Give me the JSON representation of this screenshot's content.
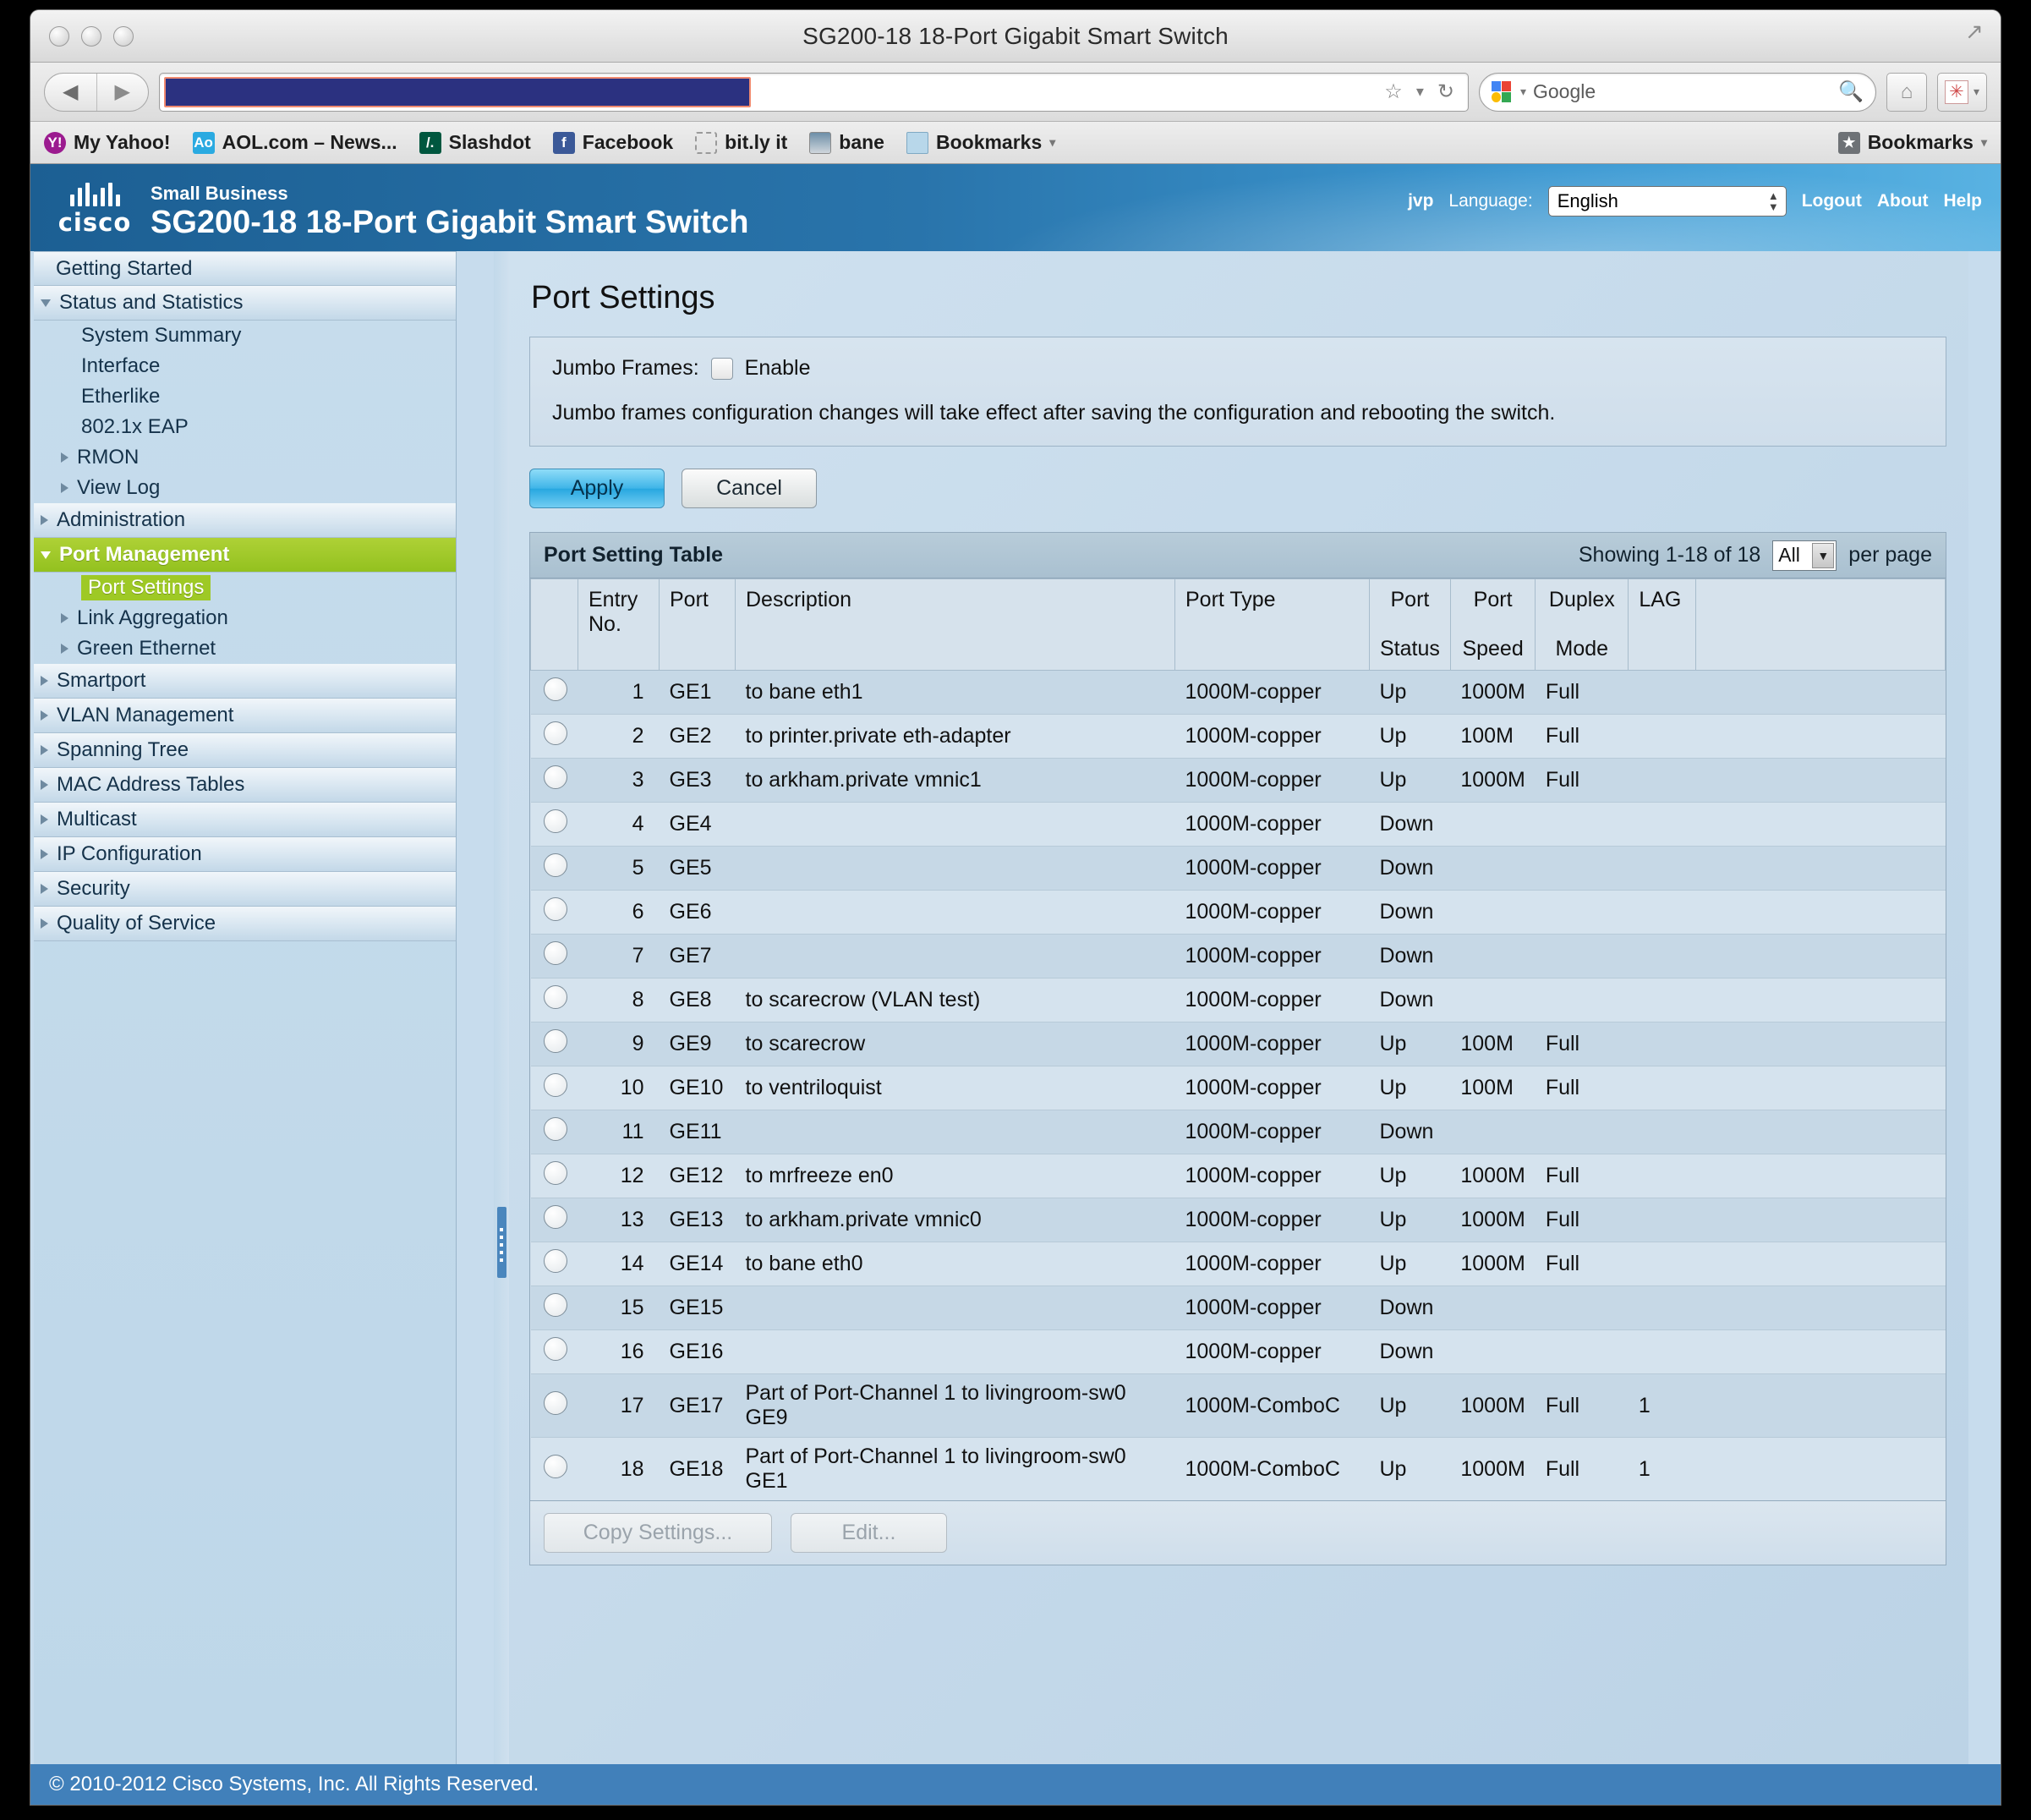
{
  "browser": {
    "window_title": "SG200-18 18-Port Gigabit Smart Switch",
    "url_value": "",
    "search_engine": "Google",
    "bookmarks": [
      {
        "label": "My Yahoo!",
        "icon": "yahoo-icon"
      },
      {
        "label": "AOL.com – News...",
        "icon": "aol-icon"
      },
      {
        "label": "Slashdot",
        "icon": "slashdot-icon"
      },
      {
        "label": "Facebook",
        "icon": "facebook-icon"
      },
      {
        "label": "bit.ly it",
        "icon": "bitly-icon"
      },
      {
        "label": "bane",
        "icon": "computer-icon"
      },
      {
        "label": "Bookmarks",
        "icon": "folder-icon"
      }
    ],
    "bookmarks_right_label": "Bookmarks"
  },
  "header": {
    "logo_word": "cisco",
    "brand_small": "Small Business",
    "brand_title": "SG200-18 18-Port Gigabit Smart Switch",
    "user": "jvp",
    "language_label": "Language:",
    "language_value": "English",
    "links": [
      "Logout",
      "About",
      "Help"
    ]
  },
  "sidebar": {
    "items": [
      {
        "label": "Getting Started",
        "level": "top",
        "arrow": "none",
        "state": "normal"
      },
      {
        "label": "Status and Statistics",
        "level": "top",
        "arrow": "down",
        "state": "normal"
      },
      {
        "label": "System Summary",
        "level": "sub",
        "arrow": "none",
        "state": "normal"
      },
      {
        "label": "Interface",
        "level": "sub",
        "arrow": "none",
        "state": "normal"
      },
      {
        "label": "Etherlike",
        "level": "sub",
        "arrow": "none",
        "state": "normal"
      },
      {
        "label": "802.1x EAP",
        "level": "sub",
        "arrow": "none",
        "state": "normal"
      },
      {
        "label": "RMON",
        "level": "sub",
        "arrow": "right",
        "state": "normal"
      },
      {
        "label": "View Log",
        "level": "sub",
        "arrow": "right",
        "state": "normal"
      },
      {
        "label": "Administration",
        "level": "top",
        "arrow": "right",
        "state": "normal"
      },
      {
        "label": "Port Management",
        "level": "top",
        "arrow": "down",
        "state": "selected"
      },
      {
        "label": "Port Settings",
        "level": "sub",
        "arrow": "none",
        "state": "highlighted"
      },
      {
        "label": "Link Aggregation",
        "level": "sub",
        "arrow": "right",
        "state": "normal"
      },
      {
        "label": "Green Ethernet",
        "level": "sub",
        "arrow": "right",
        "state": "normal"
      },
      {
        "label": "Smartport",
        "level": "top",
        "arrow": "right",
        "state": "normal"
      },
      {
        "label": "VLAN Management",
        "level": "top",
        "arrow": "right",
        "state": "normal"
      },
      {
        "label": "Spanning Tree",
        "level": "top",
        "arrow": "right",
        "state": "normal"
      },
      {
        "label": "MAC Address Tables",
        "level": "top",
        "arrow": "right",
        "state": "normal"
      },
      {
        "label": "Multicast",
        "level": "top",
        "arrow": "right",
        "state": "normal"
      },
      {
        "label": "IP Configuration",
        "level": "top",
        "arrow": "right",
        "state": "normal"
      },
      {
        "label": "Security",
        "level": "top",
        "arrow": "right",
        "state": "normal"
      },
      {
        "label": "Quality of Service",
        "level": "top",
        "arrow": "right",
        "state": "normal"
      }
    ]
  },
  "main": {
    "page_title": "Port Settings",
    "jumbo_label": "Jumbo Frames:",
    "jumbo_enable_label": "Enable",
    "jumbo_checked": false,
    "jumbo_note": "Jumbo frames configuration changes will take effect after saving the configuration and rebooting the switch.",
    "apply_label": "Apply",
    "cancel_label": "Cancel",
    "table": {
      "caption": "Port Setting Table",
      "showing": "Showing 1-18 of 18",
      "per_page_value": "All",
      "per_page_label": "per page",
      "columns": [
        "Entry No.",
        "Port",
        "Description",
        "Port Type",
        "Port Status",
        "Port Speed",
        "Duplex Mode",
        "LAG"
      ],
      "columns_line1": [
        "Entry No.",
        "Port",
        "Description",
        "Port Type",
        "Port",
        "Port",
        "Duplex",
        "LAG"
      ],
      "columns_line2": [
        "",
        "",
        "",
        "",
        "Status",
        "Speed",
        "Mode",
        ""
      ],
      "rows": [
        {
          "entry": "1",
          "port": "GE1",
          "description": "to bane eth1",
          "port_type": "1000M-copper",
          "status": "Up",
          "speed": "1000M",
          "duplex": "Full",
          "lag": ""
        },
        {
          "entry": "2",
          "port": "GE2",
          "description": "to printer.private eth-adapter",
          "port_type": "1000M-copper",
          "status": "Up",
          "speed": "100M",
          "duplex": "Full",
          "lag": ""
        },
        {
          "entry": "3",
          "port": "GE3",
          "description": "to arkham.private vmnic1",
          "port_type": "1000M-copper",
          "status": "Up",
          "speed": "1000M",
          "duplex": "Full",
          "lag": ""
        },
        {
          "entry": "4",
          "port": "GE4",
          "description": "",
          "port_type": "1000M-copper",
          "status": "Down",
          "speed": "",
          "duplex": "",
          "lag": ""
        },
        {
          "entry": "5",
          "port": "GE5",
          "description": "",
          "port_type": "1000M-copper",
          "status": "Down",
          "speed": "",
          "duplex": "",
          "lag": ""
        },
        {
          "entry": "6",
          "port": "GE6",
          "description": "",
          "port_type": "1000M-copper",
          "status": "Down",
          "speed": "",
          "duplex": "",
          "lag": ""
        },
        {
          "entry": "7",
          "port": "GE7",
          "description": "",
          "port_type": "1000M-copper",
          "status": "Down",
          "speed": "",
          "duplex": "",
          "lag": ""
        },
        {
          "entry": "8",
          "port": "GE8",
          "description": "to scarecrow (VLAN test)",
          "port_type": "1000M-copper",
          "status": "Down",
          "speed": "",
          "duplex": "",
          "lag": ""
        },
        {
          "entry": "9",
          "port": "GE9",
          "description": "to scarecrow",
          "port_type": "1000M-copper",
          "status": "Up",
          "speed": "100M",
          "duplex": "Full",
          "lag": ""
        },
        {
          "entry": "10",
          "port": "GE10",
          "description": "to ventriloquist",
          "port_type": "1000M-copper",
          "status": "Up",
          "speed": "100M",
          "duplex": "Full",
          "lag": ""
        },
        {
          "entry": "11",
          "port": "GE11",
          "description": "",
          "port_type": "1000M-copper",
          "status": "Down",
          "speed": "",
          "duplex": "",
          "lag": ""
        },
        {
          "entry": "12",
          "port": "GE12",
          "description": "to mrfreeze en0",
          "port_type": "1000M-copper",
          "status": "Up",
          "speed": "1000M",
          "duplex": "Full",
          "lag": ""
        },
        {
          "entry": "13",
          "port": "GE13",
          "description": "to arkham.private vmnic0",
          "port_type": "1000M-copper",
          "status": "Up",
          "speed": "1000M",
          "duplex": "Full",
          "lag": ""
        },
        {
          "entry": "14",
          "port": "GE14",
          "description": "to bane eth0",
          "port_type": "1000M-copper",
          "status": "Up",
          "speed": "1000M",
          "duplex": "Full",
          "lag": ""
        },
        {
          "entry": "15",
          "port": "GE15",
          "description": "",
          "port_type": "1000M-copper",
          "status": "Down",
          "speed": "",
          "duplex": "",
          "lag": ""
        },
        {
          "entry": "16",
          "port": "GE16",
          "description": "",
          "port_type": "1000M-copper",
          "status": "Down",
          "speed": "",
          "duplex": "",
          "lag": ""
        },
        {
          "entry": "17",
          "port": "GE17",
          "description": "Part of Port-Channel 1 to livingroom-sw0 GE9",
          "port_type": "1000M-ComboC",
          "status": "Up",
          "speed": "1000M",
          "duplex": "Full",
          "lag": "1"
        },
        {
          "entry": "18",
          "port": "GE18",
          "description": "Part of Port-Channel 1 to livingroom-sw0 GE1",
          "port_type": "1000M-ComboC",
          "status": "Up",
          "speed": "1000M",
          "duplex": "Full",
          "lag": "1"
        }
      ],
      "copy_settings_label": "Copy Settings...",
      "edit_label": "Edit..."
    }
  },
  "footer": {
    "copyright": "© 2010-2012 Cisco Systems, Inc. All Rights Reserved."
  },
  "colors": {
    "accent_green": "#9ec925",
    "cisco_blue": "#2974ab",
    "footer_blue": "#4180ba",
    "url_selection": "#2b3180",
    "url_selection_border": "#f08a70"
  }
}
